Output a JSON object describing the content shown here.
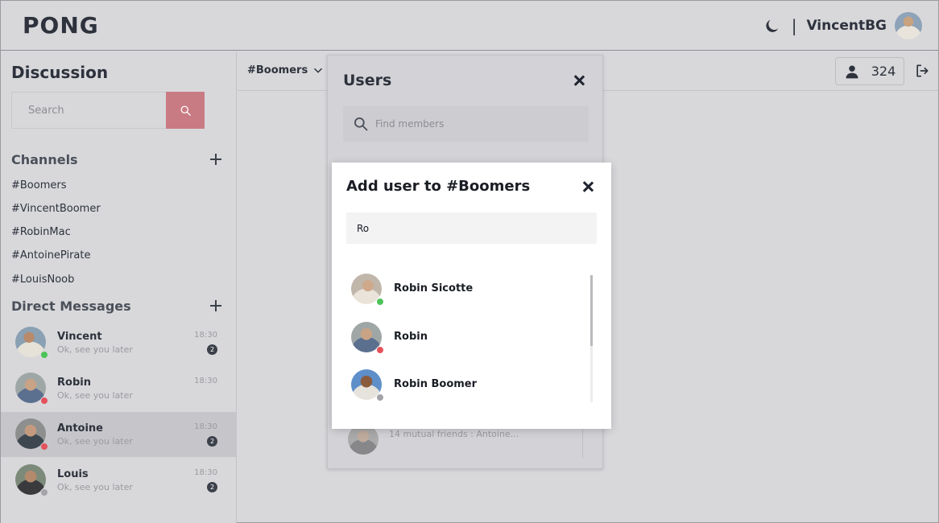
{
  "app": {
    "logo": "PONG"
  },
  "header": {
    "separator": "|",
    "username": "VincentBG"
  },
  "sidebar": {
    "title": "Discussion",
    "search_placeholder": "Search",
    "channels_title": "Channels",
    "channels": [
      "#Boomers",
      "#VincentBoomer",
      "#RobinMac",
      "#AntoinePirate",
      "#LouisNoob"
    ],
    "dm_title": "Direct Messages",
    "dms": [
      {
        "name": "Vincent",
        "last": "Ok, see you later",
        "time": "18:30",
        "badge": "2",
        "status": "#4cc35a"
      },
      {
        "name": "Robin",
        "last": "Ok, see you later",
        "time": "18:30",
        "badge": "",
        "status": "#e5525b"
      },
      {
        "name": "Antoine",
        "last": "Ok, see you later",
        "time": "18:30",
        "badge": "2",
        "status": "#e5525b"
      },
      {
        "name": "Louis",
        "last": "Ok, see you later",
        "time": "18:30",
        "badge": "2",
        "status": "#a3a3a8"
      }
    ]
  },
  "chanbar": {
    "channel": "#Boomers",
    "members_count": "324"
  },
  "users_panel": {
    "title": "Users",
    "find_placeholder": "Find members",
    "partial_row": "14 mutual friends : Antoine..."
  },
  "modal": {
    "title": "Add user to #Boomers",
    "input_value": "Ro",
    "results": [
      {
        "name": "Robin Sicotte",
        "status": "#4cc35a"
      },
      {
        "name": "Robin",
        "status": "#e5525b"
      },
      {
        "name": "Robin Boomer",
        "status": "#a3a3a8"
      }
    ]
  },
  "colors": {
    "accent": "#c97b83",
    "online": "#4cc35a",
    "busy": "#e5525b",
    "offline": "#a3a3a8"
  }
}
